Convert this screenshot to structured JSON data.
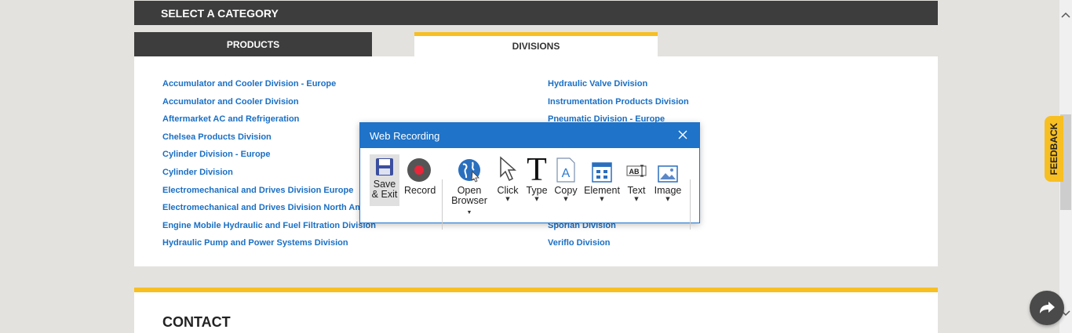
{
  "header": {
    "title": "SELECT A CATEGORY"
  },
  "tabs": {
    "products": "PRODUCTS",
    "divisions": "DIVISIONS"
  },
  "divisions": {
    "left": [
      "Accumulator and Cooler Division - Europe",
      "Accumulator and Cooler Division",
      "Aftermarket AC and Refrigeration",
      "Chelsea Products Division",
      "Cylinder Division - Europe",
      "Cylinder Division",
      "Electromechanical and Drives Division Europe",
      "Electromechanical and Drives Division North Amer",
      "Engine Mobile Hydraulic and Fuel Filtration Division",
      "Hydraulic Pump and Power Systems Division"
    ],
    "right": [
      "Hydraulic Valve Division",
      "Instrumentation Products Division",
      "Pneumatic Division - Europe",
      "",
      "",
      "",
      "",
      "",
      "Sporlan Division",
      "Veriflo Division"
    ]
  },
  "contact": {
    "title": "CONTACT"
  },
  "feedback": {
    "label": "FEEDBACK"
  },
  "dialog": {
    "title": "Web Recording",
    "tools": {
      "save_line1": "Save",
      "save_line2": "& Exit",
      "record": "Record",
      "open_line1": "Open",
      "open_line2": "Browser",
      "click": "Click",
      "type": "Type",
      "copy": "Copy",
      "element": "Element",
      "text": "Text",
      "image": "Image"
    }
  },
  "colors": {
    "accent": "#f8bf22",
    "dark": "#3d3d3d",
    "link": "#1a6fc4",
    "dialog_blue": "#1f73c8",
    "record_red": "#e8263a"
  }
}
